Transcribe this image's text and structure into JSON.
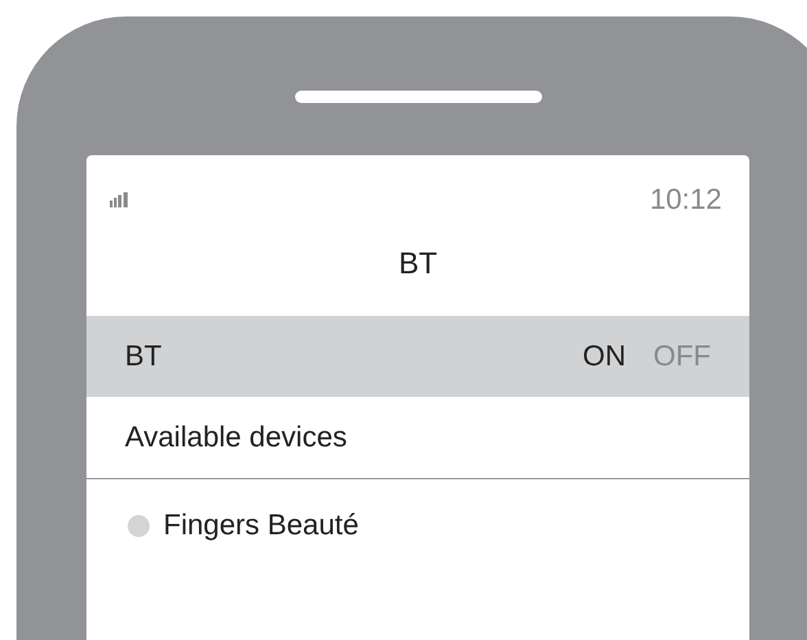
{
  "status_bar": {
    "time": "10:12"
  },
  "title": "BT",
  "bt_row": {
    "label": "BT",
    "options": [
      {
        "label": "ON",
        "selected": true
      },
      {
        "label": "OFF",
        "selected": false
      }
    ]
  },
  "section_header": "Available devices",
  "devices": [
    {
      "name": "Fingers Beauté"
    }
  ]
}
